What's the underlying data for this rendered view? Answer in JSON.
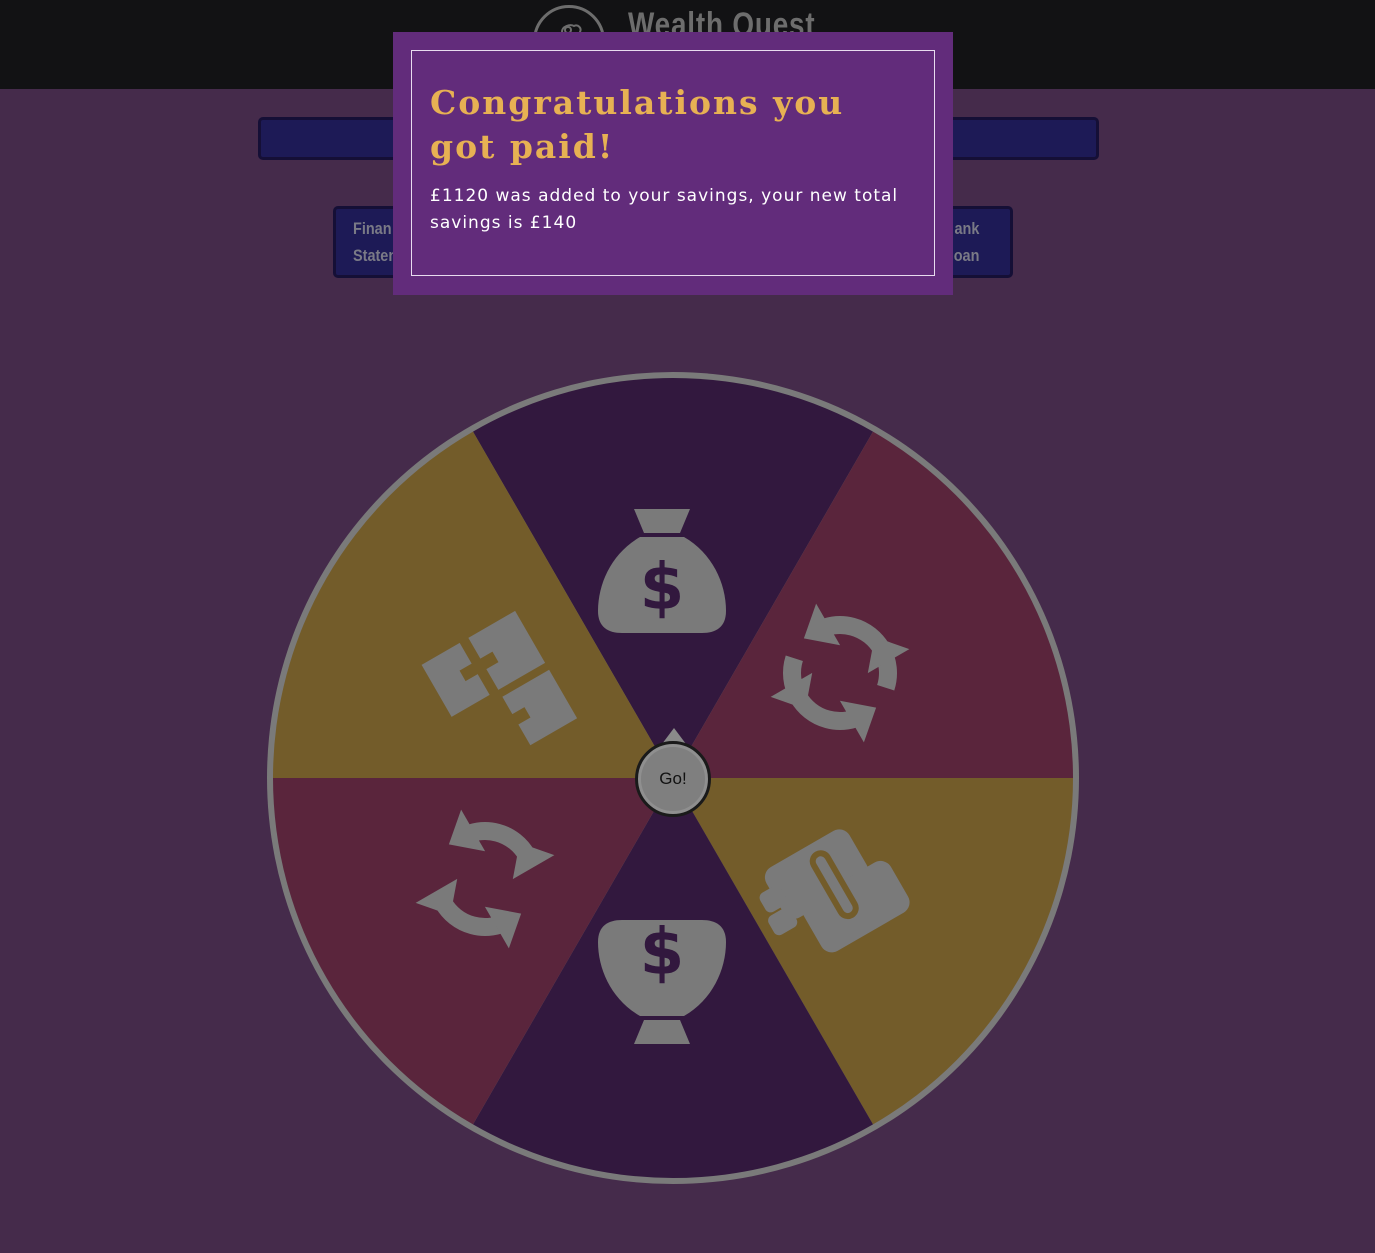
{
  "header": {
    "app_name": "Wealth Quest",
    "logo_icon": "piggy-bank-icon"
  },
  "nav": {
    "left_label_line1": "Finan",
    "left_label_line2": "Staten",
    "right_label_line1": "ank",
    "right_label_line2": "oan"
  },
  "wheel": {
    "go_label": "Go!",
    "segments": [
      {
        "icon": "money-bag-icon",
        "color": "#32183e"
      },
      {
        "icon": "refresh-arrows-icon",
        "color": "#5a253c"
      },
      {
        "icon": "handshake-icon",
        "color": "#735c2a"
      },
      {
        "icon": "money-bag-inverted-icon",
        "color": "#32183e"
      },
      {
        "icon": "refresh-arrows-icon",
        "color": "#5a253c"
      },
      {
        "icon": "puzzle-pieces-icon",
        "color": "#735c2a"
      }
    ],
    "rim_color": "#7a7a7a",
    "icon_color": "#7a7a7a"
  },
  "modal": {
    "title": "Congratulations you got paid!",
    "body": "£1120 was added to your savings, your new total savings is £140",
    "title_color": "#e7b153",
    "background": "#622c7b"
  }
}
